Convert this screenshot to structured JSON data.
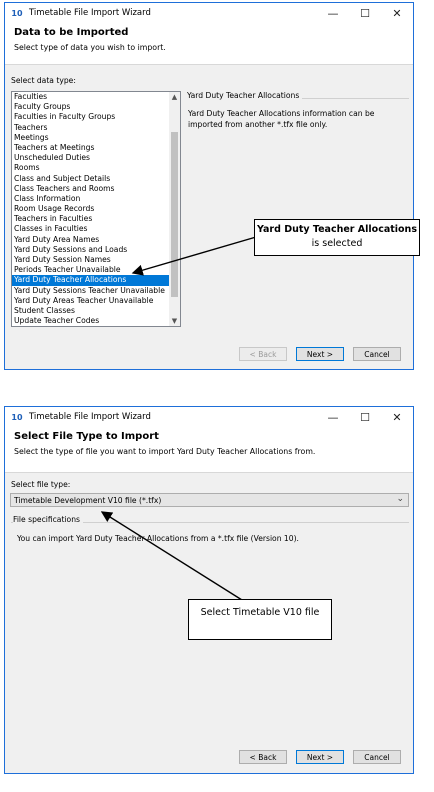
{
  "window1": {
    "title": "Timetable File Import Wizard",
    "header_title": "Data to be Imported",
    "header_sub": "Select type of data you wish to import.",
    "select_label": "Select data type:",
    "items": [
      "Faculties",
      "Faculty Groups",
      "Faculties in Faculty Groups",
      "Teachers",
      "Meetings",
      "Teachers at Meetings",
      "Unscheduled Duties",
      "Rooms",
      "Class and Subject Details",
      "Class Teachers and Rooms",
      "Class Information",
      "Room Usage Records",
      "Teachers in Faculties",
      "Classes in Faculties",
      "Yard Duty Area Names",
      "Yard Duty Sessions and Loads",
      "Yard Duty Session Names",
      "Periods Teacher Unavailable",
      "Yard Duty Teacher Allocations",
      "Yard Duty Sessions Teacher Unavailable",
      "Yard Duty Areas Teacher Unavailable",
      "Student Classes",
      "Update Teacher Codes"
    ],
    "selected_item": "Yard Duty Teacher Allocations",
    "info_title": "Yard Duty Teacher Allocations",
    "info_text": "Yard Duty Teacher Allocations information can be imported from another *.tfx file only.",
    "back": "< Back",
    "next": "Next >",
    "cancel": "Cancel"
  },
  "window2": {
    "title": "Timetable File Import Wizard",
    "header_title": "Select File Type to Import",
    "header_sub": "Select the type of file you want to import Yard Duty Teacher Allocations from.",
    "select_label": "Select file type:",
    "dropdown_value": "Timetable Development V10 file (*.tfx)",
    "spec_title": "File specifications",
    "spec_text": "You can import Yard Duty Teacher Allocations from a *.tfx file (Version 10).",
    "back": "< Back",
    "next": "Next >",
    "cancel": "Cancel"
  },
  "callout1": {
    "bold": "Yard Duty Teacher Allocations",
    "rest": "is selected"
  },
  "callout2": {
    "text": "Select Timetable V10 file"
  },
  "window_controls": {
    "minimize": "—",
    "maximize": "☐",
    "close": "✕"
  },
  "app_icon": "10"
}
